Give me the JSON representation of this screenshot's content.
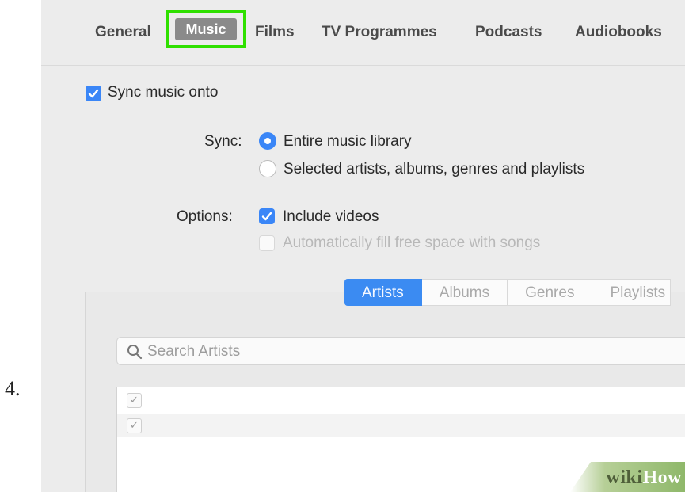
{
  "step": {
    "number": "4."
  },
  "tabs": [
    {
      "label": "General"
    },
    {
      "label": "Music",
      "selected": true
    },
    {
      "label": "Films"
    },
    {
      "label": "TV Programmes"
    },
    {
      "label": "Podcasts"
    },
    {
      "label": "Audiobooks"
    }
  ],
  "sync_music": {
    "label": "Sync music onto",
    "checked": true
  },
  "sync": {
    "label": "Sync:",
    "options": [
      {
        "label": "Entire music library",
        "selected": true
      },
      {
        "label": "Selected artists, albums, genres and playlists",
        "selected": false
      }
    ]
  },
  "options": {
    "label": "Options:",
    "items": [
      {
        "label": "Include videos",
        "checked": true,
        "enabled": true
      },
      {
        "label": "Automatically fill free space with songs",
        "checked": false,
        "enabled": false
      }
    ]
  },
  "browse_tabs": [
    {
      "label": "Artists",
      "active": true
    },
    {
      "label": "Albums"
    },
    {
      "label": "Genres"
    },
    {
      "label": "Playlists"
    }
  ],
  "search": {
    "placeholder": "Search Artists"
  },
  "list_rows": [
    {
      "checked": true
    },
    {
      "checked": true
    }
  ],
  "watermark": {
    "part1": "wiki",
    "part2": "How"
  },
  "colors": {
    "highlight": "#2fe000",
    "accent": "#3a86f7"
  },
  "icons": {
    "checkbox": "checkmark-icon",
    "search": "magnifier-icon"
  }
}
